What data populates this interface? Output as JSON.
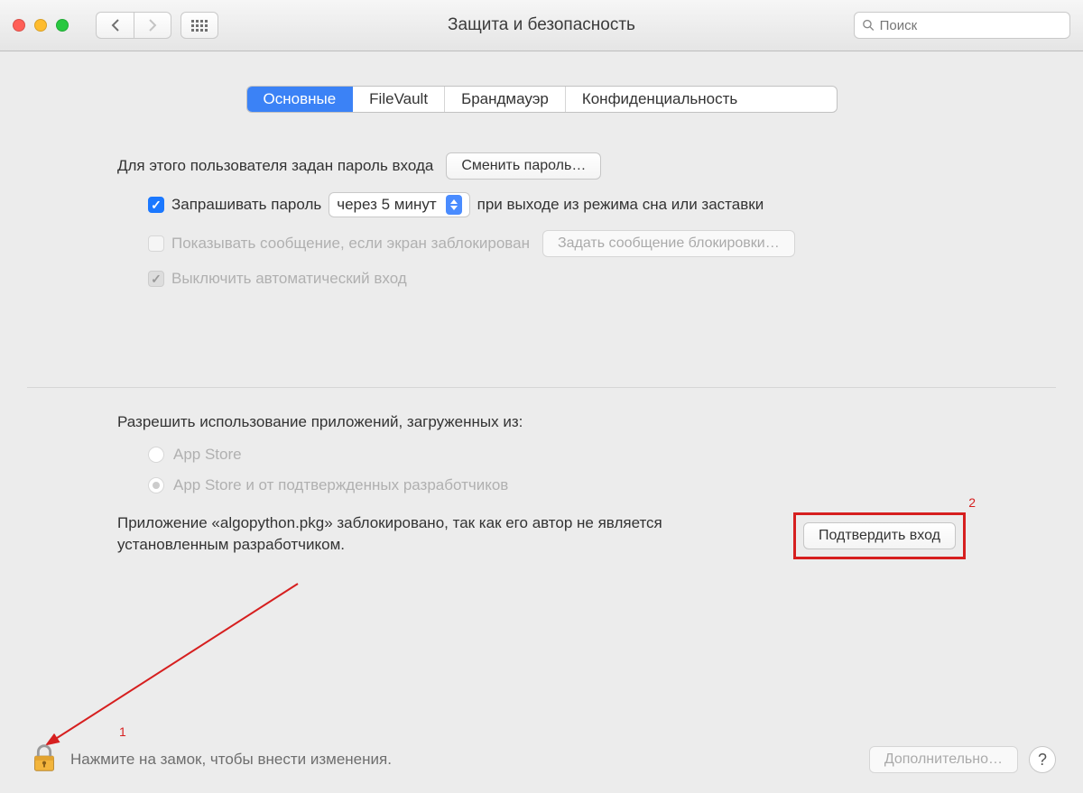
{
  "toolbar": {
    "title": "Защита и безопасность",
    "search_placeholder": "Поиск"
  },
  "tabs": [
    "Основные",
    "FileVault",
    "Брандмауэр",
    "Конфиденциальность"
  ],
  "section1": {
    "password_set_label": "Для этого пользователя задан пароль входа",
    "change_password_btn": "Сменить пароль…",
    "require_pw_label": "Запрашивать пароль",
    "require_pw_select": "через 5 минут",
    "require_pw_suffix": "при выходе из режима сна или заставки",
    "show_msg_label": "Показывать сообщение, если экран заблокирован",
    "set_lock_msg_btn": "Задать сообщение блокировки…",
    "disable_autologin_label": "Выключить автоматический вход"
  },
  "section2": {
    "allow_apps_label": "Разрешить использование приложений, загруженных из:",
    "radio1": "App Store",
    "radio2": "App Store и от подтвержденных разработчиков",
    "blocked_msg": "Приложение «algopython.pkg» заблокировано, так как его автор не является установленным разработчиком.",
    "confirm_btn": "Подтвердить вход"
  },
  "footer": {
    "lock_text": "Нажмите на замок, чтобы внести изменения.",
    "advanced_btn": "Дополнительно…"
  },
  "annotations": {
    "n1": "1",
    "n2": "2"
  }
}
